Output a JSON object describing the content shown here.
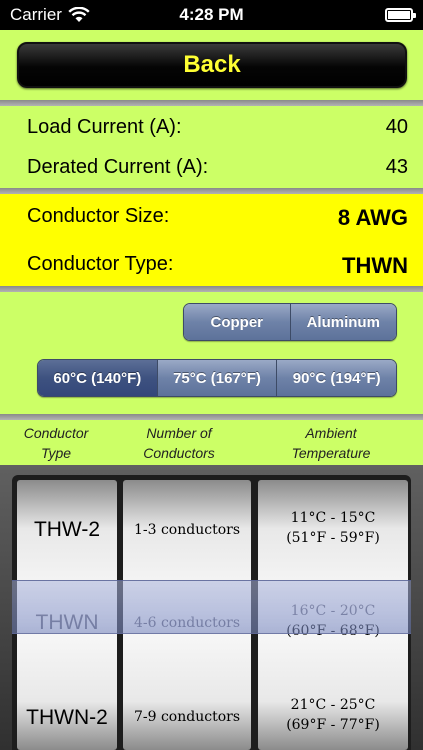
{
  "status": {
    "carrier": "Carrier",
    "time": "4:28 PM"
  },
  "back_label": "Back",
  "load_current": {
    "label": "Load Current (A):",
    "value": "40"
  },
  "derated_current": {
    "label": "Derated Current (A):",
    "value": "43"
  },
  "conductor_size": {
    "label": "Conductor Size:",
    "value": "8 AWG"
  },
  "conductor_type": {
    "label": "Conductor Type:",
    "value": "THWN"
  },
  "material": {
    "options": [
      "Copper",
      "Aluminum"
    ],
    "selected": "Copper"
  },
  "temperature_rating": {
    "options": [
      "60°C (140°F)",
      "75°C (167°F)",
      "90°C (194°F)"
    ],
    "selected": "60°C (140°F)"
  },
  "columns": {
    "type": [
      "Conductor",
      "Type"
    ],
    "count": [
      "Number of",
      "Conductors"
    ],
    "ambient": [
      "Ambient",
      "Temperature"
    ]
  },
  "picker": {
    "types": [
      "THW-2",
      "THWN",
      "THWN-2"
    ],
    "counts": [
      "1-3 conductors",
      "4-6 conductors",
      "7-9 conductors"
    ],
    "temps": [
      [
        "11°C - 15°C",
        "(51°F - 59°F)"
      ],
      [
        "16°C - 20°C",
        "(60°F - 68°F)"
      ],
      [
        "21°C - 25°C",
        "(69°F - 77°F)"
      ]
    ]
  },
  "colors": {
    "background": "#ccff66",
    "highlight": "#ffff00",
    "back_text": "#ffff33"
  }
}
